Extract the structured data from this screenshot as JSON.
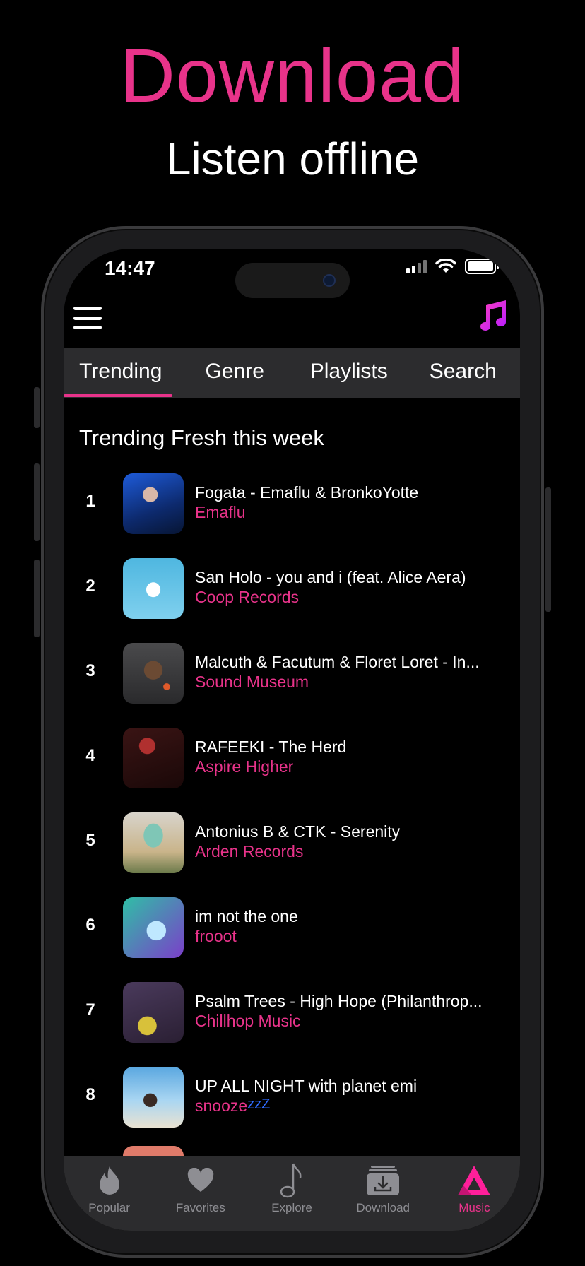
{
  "hero": {
    "title": "Download",
    "subtitle": "Listen offline"
  },
  "status_bar": {
    "time": "14:47"
  },
  "header": {
    "menu_icon": "hamburger-icon",
    "logo_icon": "music-note-icon"
  },
  "top_tabs": [
    {
      "label": "Trending",
      "active": true
    },
    {
      "label": "Genre",
      "active": false
    },
    {
      "label": "Playlists",
      "active": false
    },
    {
      "label": "Search",
      "active": false
    }
  ],
  "section": {
    "title": "Trending Fresh this week"
  },
  "tracks": [
    {
      "rank": "1",
      "title": "Fogata - Emaflu & BronkoYotte",
      "artist": "Emaflu"
    },
    {
      "rank": "2",
      "title": "San Holo - you and i (feat. Alice Aera)",
      "artist": "Coop Records"
    },
    {
      "rank": "3",
      "title": "Malcuth & Facutum & Floret Loret - In...",
      "artist": "Sound Museum"
    },
    {
      "rank": "4",
      "title": "RAFEEKI - The Herd",
      "artist": "Aspire Higher"
    },
    {
      "rank": "5",
      "title": "Antonius B & CTK - Serenity",
      "artist": "Arden Records"
    },
    {
      "rank": "6",
      "title": "im not the one",
      "artist": "frooot"
    },
    {
      "rank": "7",
      "title": "Psalm Trees - High Hope (Philanthrop...",
      "artist": "Chillhop Music"
    },
    {
      "rank": "8",
      "title": "UP ALL NIGHT with planet emi",
      "artist": "snooze",
      "artist_suffix": "zzZ"
    }
  ],
  "bottom_tabs": [
    {
      "label": "Popular",
      "icon": "flame-icon",
      "active": false
    },
    {
      "label": "Favorites",
      "icon": "heart-icon",
      "active": false
    },
    {
      "label": "Explore",
      "icon": "music-note-icon",
      "active": false
    },
    {
      "label": "Download",
      "icon": "download-tray-icon",
      "active": false
    },
    {
      "label": "Music",
      "icon": "triangle-logo-icon",
      "active": true
    }
  ],
  "colors": {
    "accent": "#e8338a",
    "background": "#000000",
    "bar_background": "#2c2c2e",
    "inactive_tab": "#8e8e93"
  }
}
